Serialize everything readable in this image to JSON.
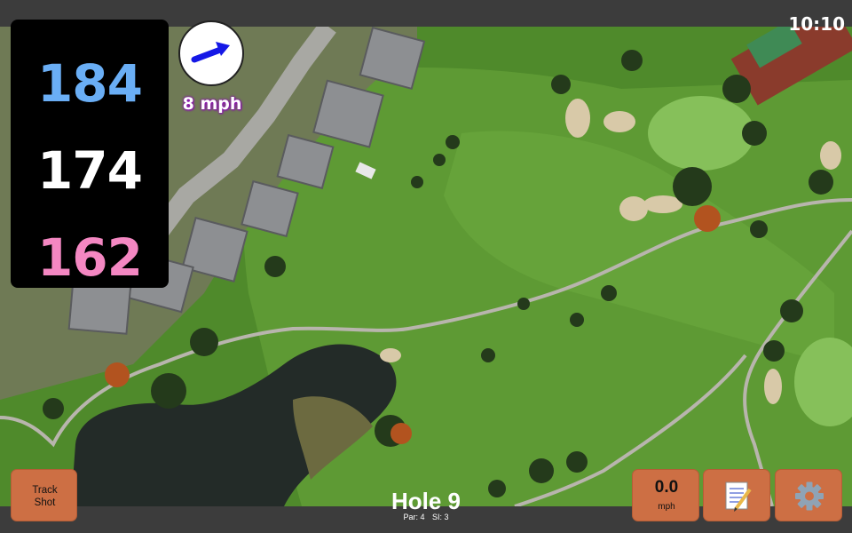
{
  "status": {
    "time": "10:10"
  },
  "distances": {
    "back": "184",
    "middle": "174",
    "front": "162"
  },
  "wind": {
    "speed_label": "8 mph",
    "arrow_color": "#1518e6",
    "label_color": "#8a0fb0"
  },
  "track_button": {
    "line1": "Track",
    "line2": "Shot"
  },
  "speed_button": {
    "value": "0.0",
    "unit": "mph"
  },
  "notes_button": {
    "icon": "notepad-icon"
  },
  "settings_button": {
    "icon": "gear-icon"
  },
  "hole": {
    "title": "Hole 9",
    "par_label": "Par: 4",
    "si_label": "SI: 3"
  },
  "colors": {
    "button": "#cd6f44",
    "back_distance": "#6aaef5",
    "front_distance": "#f487c2",
    "fairway": "#5e9a34"
  }
}
